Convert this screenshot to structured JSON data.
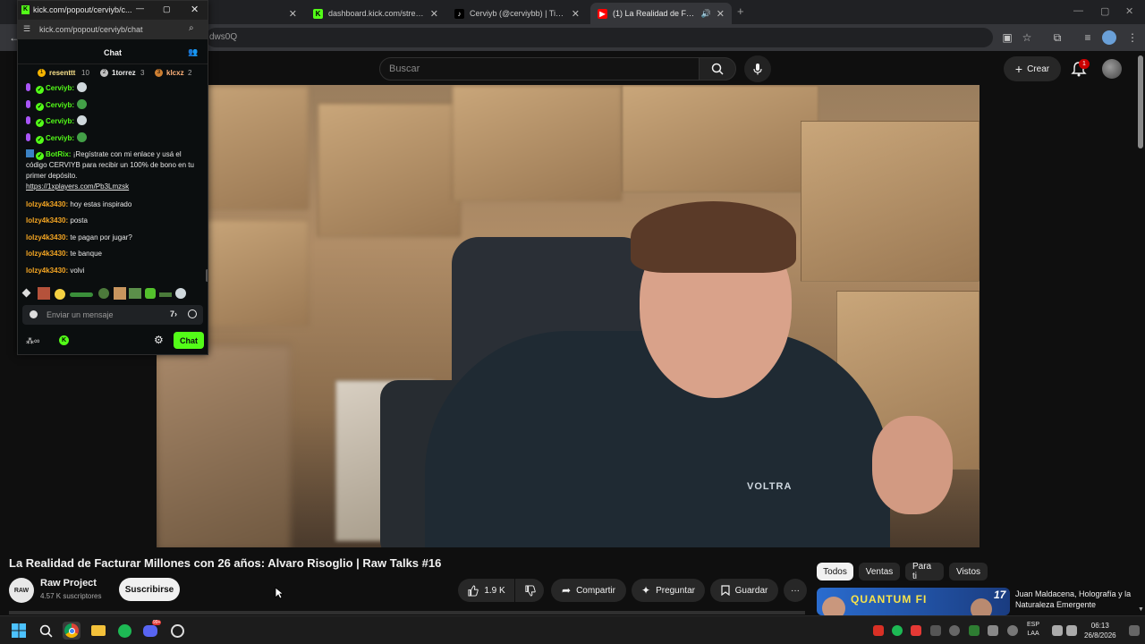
{
  "browser": {
    "tabs": [
      {
        "title": "Cerviyb (@cerviybb) | TikTok",
        "favicon": "tiktok-icon"
      },
      {
        "title": "dashboard.kick.com/stream",
        "favicon": "kick-icon"
      },
      {
        "title": "(1) La Realidad de Facturar M",
        "favicon": "youtube-icon",
        "active": true
      }
    ],
    "new_tab": "+",
    "address_partial": "dws0Q"
  },
  "youtube": {
    "search_placeholder": "Buscar",
    "create_label": "Crear",
    "notification_count": "1",
    "video_title": "La Realidad de Facturar Millones con 26 años: Alvaro Risoglio | Raw Talks #16",
    "channel": {
      "name": "Raw Project",
      "subscribers": "4.57 K suscriptores",
      "avatar_text": "RAW"
    },
    "subscribe_label": "Suscribirse",
    "likes": "1.9 K",
    "share_label": "Compartir",
    "ask_label": "Preguntar",
    "save_label": "Guardar",
    "more_label": "···",
    "chips": [
      "Todos",
      "Ventas",
      "Para ti",
      "Vistos"
    ],
    "recommendation": {
      "title": "Juan Maldacena, Holografía y la Naturaleza Emergente",
      "thumb_text": "QUANTUM FI",
      "thumb_badge": "17"
    },
    "video_overlay_text": "VOLTRA"
  },
  "kick_popout": {
    "window_title": "kick.com/popout/cerviyb/c...",
    "url": "kick.com/popout/cerviyb/chat",
    "header": "Chat",
    "pinned_gifters": [
      {
        "name": "resenttt",
        "count": "10",
        "rank": "1"
      },
      {
        "name": "1torrez",
        "count": "3",
        "rank": "2"
      },
      {
        "name": "klcxz",
        "count": "2",
        "rank": "3"
      }
    ],
    "messages": [
      {
        "user": "Cerviyb:",
        "text": "",
        "type": "streamer"
      },
      {
        "user": "Cerviyb:",
        "text": "",
        "type": "streamer"
      },
      {
        "user": "Cerviyb:",
        "text": "",
        "type": "streamer"
      },
      {
        "user": "Cerviyb:",
        "text": "",
        "type": "streamer"
      },
      {
        "user": "BotRix:",
        "text": "¡Regístrate con mi enlace y usá el código CERVIYB para recibir un 100% de bono en tu primer depósito.",
        "link": "https://1xplayers.com/Pb3Lmzsk",
        "type": "bot"
      },
      {
        "user": "lolzy4k3430:",
        "text": "hoy estas inspirado",
        "type": "viewer"
      },
      {
        "user": "lolzy4k3430:",
        "text": "posta",
        "type": "viewer"
      },
      {
        "user": "lolzy4k3430:",
        "text": "te pagan por jugar?",
        "type": "viewer"
      },
      {
        "user": "lolzy4k3430:",
        "text": "te banque",
        "type": "viewer"
      },
      {
        "user": "lolzy4k3430:",
        "text": "volvi",
        "type": "viewer"
      }
    ],
    "input_placeholder": "Enviar un mensaje",
    "chat_button": "Chat",
    "brand_color": "#53fc18"
  },
  "taskbar": {
    "lang_line1": "ESP",
    "lang_line2": "LAA",
    "time": "06:13",
    "date": "26/8/2026",
    "discord_badge": "99+"
  }
}
